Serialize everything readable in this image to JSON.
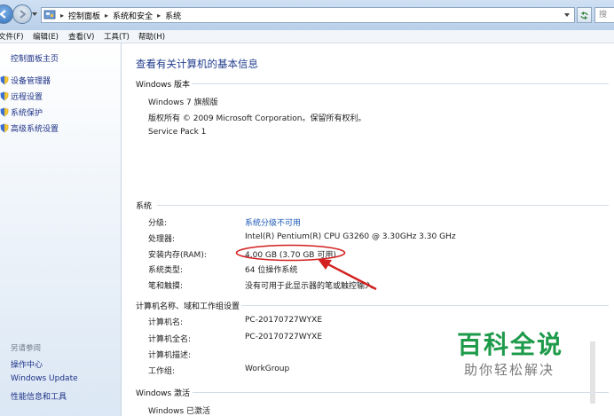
{
  "address_bar": {
    "crumbs": [
      "控制面板",
      "系统和安全",
      "系统"
    ],
    "search_placeholder": "搜"
  },
  "menu": [
    "文件(F)",
    "编辑(E)",
    "查看(V)",
    "工具(T)",
    "帮助(H)"
  ],
  "sidebar": {
    "home": "控制面板主页",
    "tasks": [
      "设备管理器",
      "远程设置",
      "系统保护",
      "高级系统设置"
    ],
    "see_also_title": "另请参阅",
    "see_also": [
      "操作中心",
      "Windows Update",
      "性能信息和工具"
    ]
  },
  "main": {
    "title": "查看有关计算机的基本信息",
    "edition": {
      "heading": "Windows 版本",
      "name": "Windows 7 旗舰版",
      "copyright": "版权所有 © 2009 Microsoft Corporation。保留所有权利。",
      "service_pack": "Service Pack 1"
    },
    "system": {
      "heading": "系统",
      "rows": [
        {
          "label": "分级:",
          "value": "系统分级不可用"
        },
        {
          "label": "处理器:",
          "value": "Intel(R) Pentium(R) CPU G3260 @ 3.30GHz   3.30 GHz"
        },
        {
          "label": "安装内存(RAM):",
          "value": "4.00 GB (3.70 GB 可用)"
        },
        {
          "label": "系统类型:",
          "value": "64 位操作系统"
        },
        {
          "label": "笔和触摸:",
          "value": "没有可用于此显示器的笔或触控输入"
        }
      ]
    },
    "computer": {
      "heading": "计算机名称、域和工作组设置",
      "rows": [
        {
          "label": "计算机名:",
          "value": "PC-20170727WYXE"
        },
        {
          "label": "计算机全名:",
          "value": "PC-20170727WYXE"
        },
        {
          "label": "计算机描述:",
          "value": ""
        },
        {
          "label": "工作组:",
          "value": "WorkGroup"
        }
      ]
    },
    "activation": {
      "heading": "Windows 激活",
      "status": "Windows 已激活"
    }
  },
  "watermark": {
    "title": "百科全说",
    "subtitle": "助你轻松解决"
  },
  "colors": {
    "link": "#1b57b5",
    "annotation": "#d32020",
    "watermark_green": "#1d9a4a"
  }
}
